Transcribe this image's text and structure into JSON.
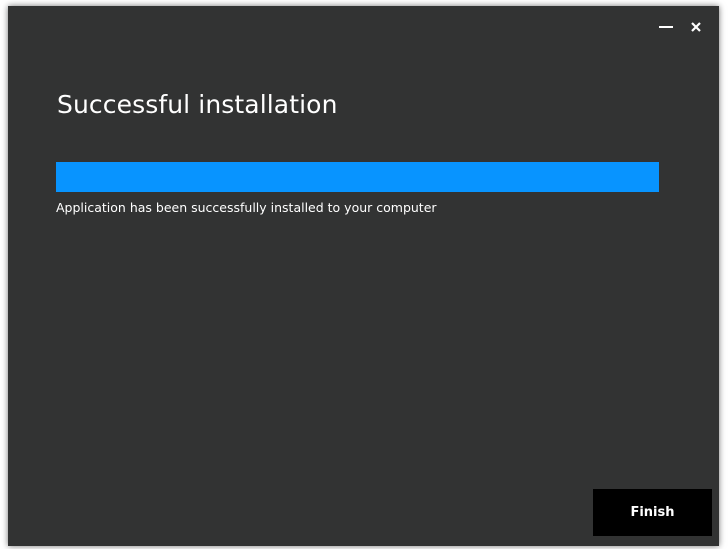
{
  "window": {
    "title": "Successful installation",
    "background": "#323333"
  },
  "controls": {
    "minimize_icon": "minimize-icon",
    "close_icon": "close-icon"
  },
  "progress": {
    "percent": 100,
    "fill_color": "#0894ff"
  },
  "status": {
    "message": "Application has been successfully installed to your computer"
  },
  "footer": {
    "finish_label": "Finish"
  }
}
